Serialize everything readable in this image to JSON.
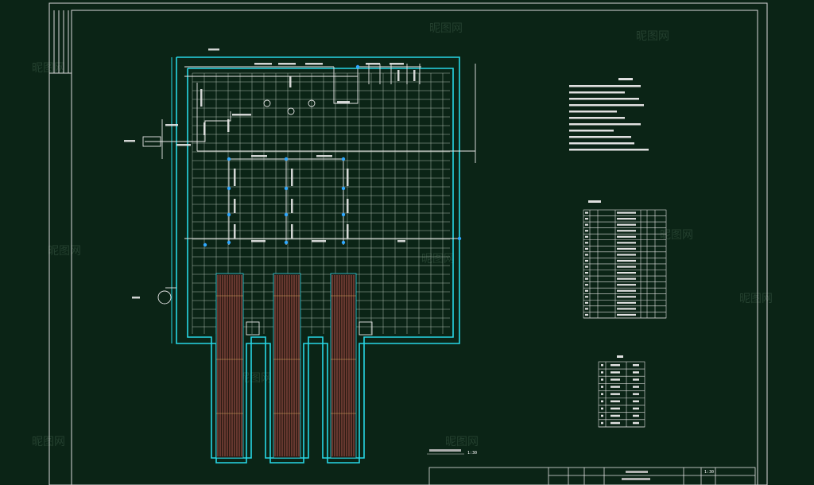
{
  "drawing": {
    "scale_note": "1:30",
    "title_block": {
      "scale": "1:30"
    }
  },
  "watermark_text": "昵图网",
  "colors": {
    "background": "#0b2416",
    "frame": "#d9d9d9",
    "wall_cyan": "#27d7e6",
    "grid": "#c8d4c8",
    "pipe": "#e8e8e8",
    "node": "#2fa8ff",
    "strip_red": "#c0645c",
    "watermark": "#24402f"
  }
}
